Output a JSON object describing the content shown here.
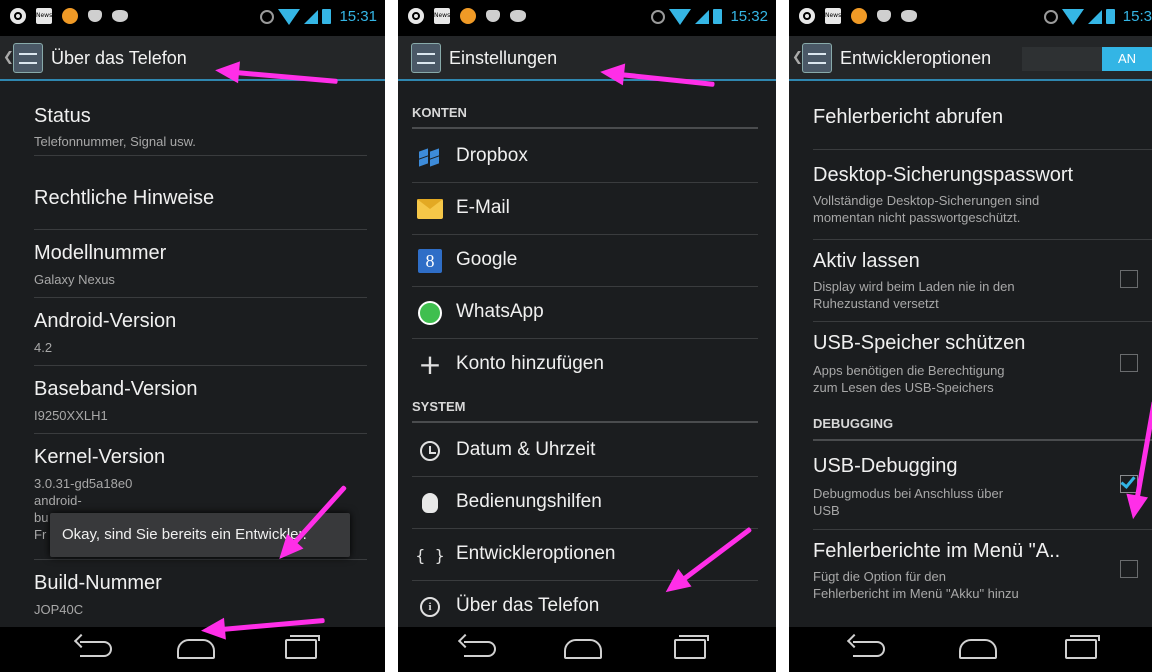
{
  "screens": [
    {
      "status_time": "15:31",
      "title": "Über das Telefon",
      "items": [
        {
          "title": "Status",
          "summary": [
            "Telefonnummer, Signal usw."
          ]
        },
        {
          "title": "Rechtliche Hinweise",
          "summary": []
        },
        {
          "title": "Modellnummer",
          "summary": [
            "Galaxy Nexus"
          ]
        },
        {
          "title": "Android-Version",
          "summary": [
            "4.2"
          ]
        },
        {
          "title": "Baseband-Version",
          "summary": [
            "I9250XXLH1"
          ]
        },
        {
          "title": "Kernel-Version",
          "summary": [
            "3.0.31-gd5a18e0",
            "android-",
            "bu",
            "Fr"
          ]
        },
        {
          "title": "Build-Nummer",
          "summary": [
            "JOP40C"
          ]
        }
      ],
      "toast": "Okay, sind Sie bereits ein Entwickler."
    },
    {
      "status_time": "15:32",
      "title": "Einstellungen",
      "sections": [
        {
          "header": "KONTEN",
          "items": [
            {
              "label": "Dropbox",
              "icon": "dropbox-icon"
            },
            {
              "label": "E-Mail",
              "icon": "email-icon"
            },
            {
              "label": "Google",
              "icon": "google-icon",
              "glyph": "8"
            },
            {
              "label": "WhatsApp",
              "icon": "whatsapp-icon"
            },
            {
              "label": "Konto hinzufügen",
              "icon": "plus-icon",
              "glyph": "+"
            }
          ]
        },
        {
          "header": "SYSTEM",
          "items": [
            {
              "label": "Datum & Uhrzeit",
              "icon": "clock-icon"
            },
            {
              "label": "Bedienungshilfen",
              "icon": "hand-icon"
            },
            {
              "label": "Entwickleroptionen",
              "icon": "braces-icon",
              "glyph": "{ }"
            },
            {
              "label": "Über das Telefon",
              "icon": "info-icon",
              "glyph": "i"
            }
          ]
        }
      ]
    },
    {
      "status_time": "15:3",
      "title": "Entwickleroptionen",
      "toggle_label": "AN",
      "items": [
        {
          "title": "Fehlerbericht abrufen",
          "summary": []
        },
        {
          "title": "Desktop-Sicherungspasswort",
          "summary": [
            "Vollständige Desktop-Sicherungen sind",
            "momentan nicht passwortgeschützt."
          ]
        },
        {
          "title": "Aktiv lassen",
          "summary": [
            "Display wird beim Laden nie in den",
            "Ruhezustand versetzt"
          ],
          "checked": false
        },
        {
          "title": "USB-Speicher schützen",
          "summary": [
            "Apps benötigen die Berechtigung",
            "zum Lesen des USB-Speichers"
          ],
          "checked": false
        },
        {
          "title": "USB-Debugging",
          "summary": [
            "Debugmodus bei Anschluss über",
            "USB"
          ],
          "checked": true
        },
        {
          "title": "Fehlerberichte im Menü \"A..",
          "summary": [
            "Fügt die Option für den",
            "Fehlerbericht im Menü \"Akku\" hinzu"
          ],
          "checked": false
        }
      ],
      "category": "DEBUGGING"
    }
  ],
  "statusbar_icons": [
    "gear-icon",
    "news-icon",
    "orange-app-icon",
    "shape-icon",
    "cat-icon"
  ],
  "statusbar_icon_labels": {
    "news": "News"
  },
  "colors": {
    "accent": "#33b5e5",
    "background": "#1b1d1f",
    "annotation_arrow": "#ff2ee8"
  }
}
